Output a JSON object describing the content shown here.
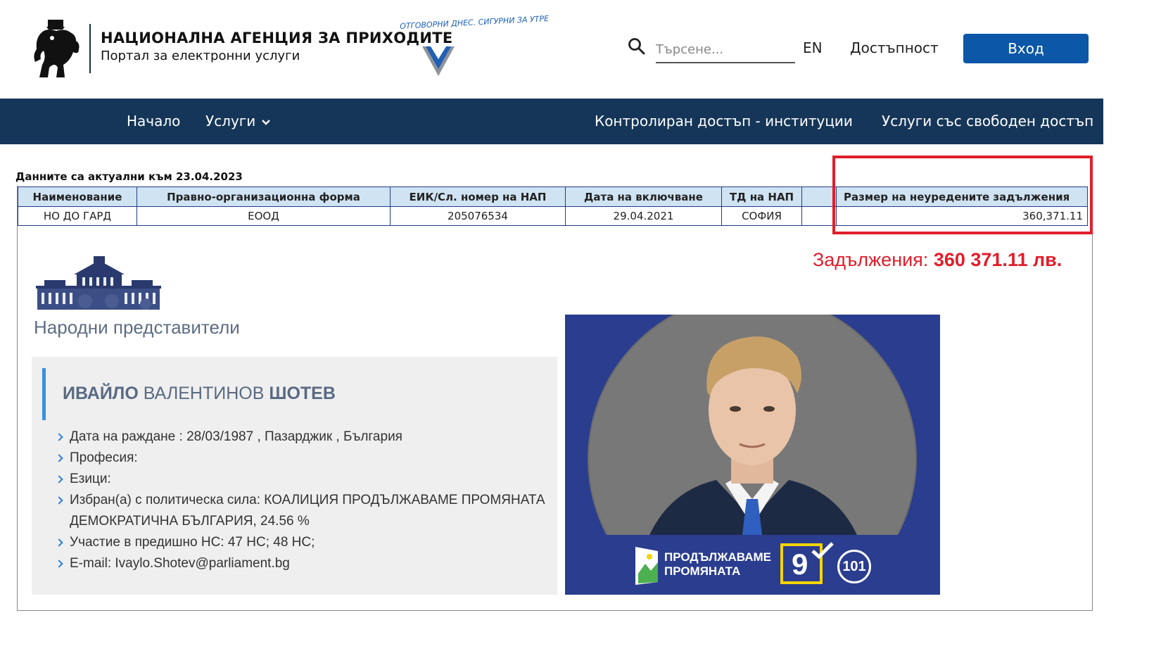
{
  "header": {
    "agency_title": "НАЦИОНАЛНА АГЕНЦИЯ ЗА ПРИХОДИТЕ",
    "agency_subtitle": "Портал за електронни услуги",
    "slogan": "ОТГОВОРНИ ДНЕС. СИГУРНИ ЗА УТРЕ",
    "search_placeholder": "Търсене...",
    "lang_label": "EN",
    "accessibility_label": "Достъпност",
    "login_label": "Вход"
  },
  "nav": {
    "items": [
      {
        "label": "Начало"
      },
      {
        "label": "Услуги"
      },
      {
        "label": "Контролиран достъп - институции"
      },
      {
        "label": "Услуги със свободен достъп"
      }
    ]
  },
  "nap_table": {
    "updated_text": "Данните са актуални към 23.04.2023",
    "headers": [
      "Наименование",
      "Правно-организационна форма",
      "ЕИК/Сл. номер на НАП",
      "Дата на включване",
      "ТД на НАП",
      "",
      "Размер на неуредените задължения"
    ],
    "row": [
      "НО ДО ГАРД",
      "ЕООД",
      "205076534",
      "29.04.2021",
      "СОФИЯ",
      "",
      "360,371.11"
    ]
  },
  "annotation": {
    "label": "Задължения:",
    "amount": "360 371.11 лв.",
    "color": "#e01e2b"
  },
  "parliament": {
    "section_title": "Народни представители",
    "mp": {
      "first_name": "ИВАЙЛО",
      "middle_name": "ВАЛЕНТИНОВ",
      "last_name": "ШОТЕВ"
    },
    "facts": [
      "Дата на раждане : 28/03/1987 , Пазарджик , България",
      "Професия:",
      "Езици:",
      "Избран(а) с политическа сила: КОАЛИЦИЯ ПРОДЪЛЖАВАМЕ ПРОМЯНАТА ДЕМОКРАТИЧНА БЪЛГАРИЯ, 24.56 %",
      "Участие в предишно НС: 47 НС; 48 НС;",
      "E-mail: Ivaylo.Shotev@parliament.bg"
    ]
  },
  "poster": {
    "party_line1": "ПРОДЪЛЖАВАМЕ",
    "party_line2": "ПРОМЯНАТА",
    "ballot_number": "9",
    "candidate_number": "101",
    "bg_color": "#2a3d8f",
    "accent_color": "#f5d400"
  },
  "colors": {
    "nav_bg": "#153658",
    "login_bg": "#0c57a8",
    "table_header_bg": "#cfe3f3"
  }
}
